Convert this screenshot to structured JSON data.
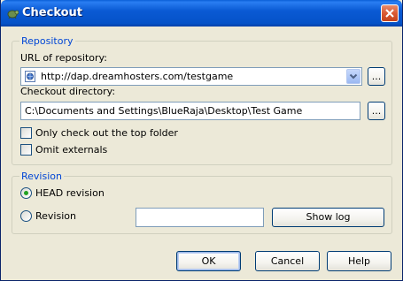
{
  "window": {
    "title": "Checkout"
  },
  "repository": {
    "legend": "Repository",
    "url_label": "URL of repository:",
    "url_value": "http://dap.dreamhosters.com/testgame",
    "url_browse_label": "...",
    "dir_label": "Checkout directory:",
    "dir_value": "C:\\Documents and Settings\\BlueRaja\\Desktop\\Test Game",
    "dir_browse_label": "...",
    "only_top_folder_label": "Only check out the top folder",
    "only_top_folder_checked": false,
    "omit_externals_label": "Omit externals",
    "omit_externals_checked": false
  },
  "revision": {
    "legend": "Revision",
    "head_label": "HEAD revision",
    "head_selected": true,
    "revision_label": "Revision",
    "revision_selected": false,
    "revision_value": "",
    "show_log_label": "Show log"
  },
  "buttons": {
    "ok_label": "OK",
    "cancel_label": "Cancel",
    "help_label": "Help"
  },
  "colors": {
    "legend_text": "#0046d5",
    "titlebar": "#0a5ad4",
    "close_button": "#d95a34",
    "radio_selected": "#21a121"
  },
  "icons": {
    "title": "tortoise-icon",
    "close": "close-icon",
    "url_favicon": "repository-page-icon",
    "dropdown": "chevron-down-icon"
  }
}
